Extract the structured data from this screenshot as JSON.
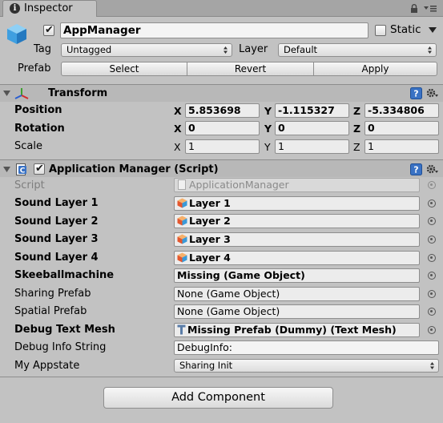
{
  "tab": {
    "title": "Inspector"
  },
  "gameobject": {
    "active": true,
    "name": "AppManager",
    "static_label": "Static",
    "static_checked": false,
    "tag_label": "Tag",
    "tag_value": "Untagged",
    "layer_label": "Layer",
    "layer_value": "Default",
    "prefab_label": "Prefab",
    "prefab_buttons": [
      "Select",
      "Revert",
      "Apply"
    ]
  },
  "transform": {
    "title": "Transform",
    "rows": [
      {
        "label": "Position",
        "x": "5.853698",
        "y": "-1.115327",
        "z": "-5.334806"
      },
      {
        "label": "Rotation",
        "x": "0",
        "y": "0",
        "z": "0"
      },
      {
        "label": "Scale",
        "x": "1",
        "y": "1",
        "z": "1"
      }
    ]
  },
  "script_component": {
    "title": "Application Manager (Script)",
    "enabled": true,
    "fields": [
      {
        "label": "Script",
        "value": "ApplicationManager"
      },
      {
        "label": "Sound Layer 1",
        "value": "Layer 1"
      },
      {
        "label": "Sound Layer 2",
        "value": "Layer 2"
      },
      {
        "label": "Sound Layer 3",
        "value": "Layer 3"
      },
      {
        "label": "Sound Layer 4",
        "value": "Layer 4"
      },
      {
        "label": "Skeeballmachine",
        "value": "Missing (Game Object)"
      },
      {
        "label": "Sharing Prefab",
        "value": "None (Game Object)"
      },
      {
        "label": "Spatial Prefab",
        "value": "None (Game Object)"
      },
      {
        "label": "Debug Text Mesh",
        "value": "Missing Prefab (Dummy) (Text Mesh)"
      },
      {
        "label": "Debug Info String",
        "value": "DebugInfo:"
      },
      {
        "label": "My Appstate",
        "value": "Sharing Init"
      }
    ]
  },
  "add_component_label": "Add Component",
  "colors": {
    "panel_bg": "#c2c2c2",
    "header_bg": "#b8b8b8",
    "field_bg": "#ececec",
    "accent_blue": "#3a72c4"
  }
}
